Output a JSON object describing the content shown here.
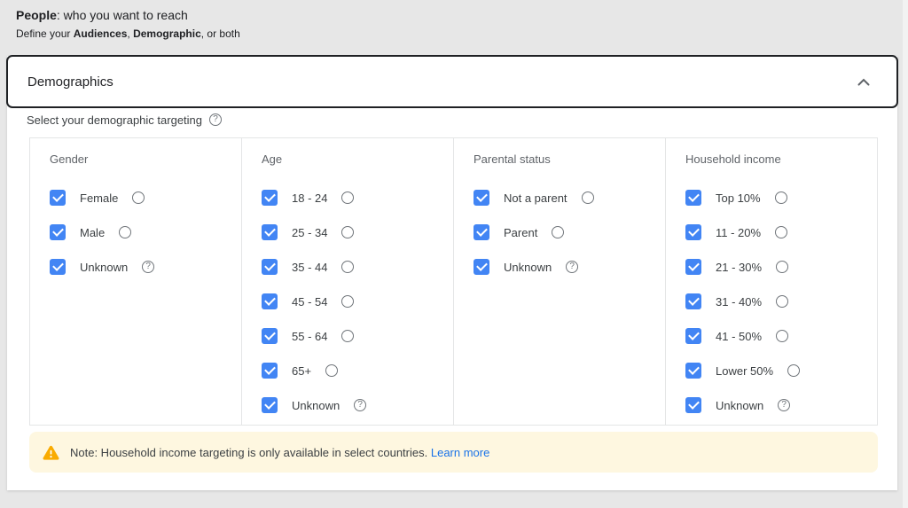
{
  "page_header": {
    "title_bold": "People",
    "title_rest": ": who you want to reach",
    "subtitle_prefix": "Define your ",
    "subtitle_bold1": "Audiences",
    "subtitle_sep": ", ",
    "subtitle_bold2": "Demographic",
    "subtitle_suffix": ", or both"
  },
  "section": {
    "title": "Demographics",
    "collapse_icon": "chevron-up-icon",
    "subtitle": "Select your demographic targeting",
    "subtitle_help_icon": "help-circle-icon",
    "help_glyph": "?"
  },
  "demographics": {
    "columns": [
      {
        "header": "Gender",
        "options": [
          {
            "label": "Female",
            "checked": true
          },
          {
            "label": "Male",
            "checked": true
          },
          {
            "label": "Unknown",
            "checked": true,
            "help": true
          }
        ]
      },
      {
        "header": "Age",
        "options": [
          {
            "label": "18 - 24",
            "checked": true
          },
          {
            "label": "25 - 34",
            "checked": true
          },
          {
            "label": "35 - 44",
            "checked": true
          },
          {
            "label": "45 - 54",
            "checked": true
          },
          {
            "label": "55 - 64",
            "checked": true
          },
          {
            "label": "65+",
            "checked": true
          },
          {
            "label": "Unknown",
            "checked": true,
            "help": true
          }
        ]
      },
      {
        "header": "Parental status",
        "options": [
          {
            "label": "Not a parent",
            "checked": true
          },
          {
            "label": "Parent",
            "checked": true
          },
          {
            "label": "Unknown",
            "checked": true,
            "help": true
          }
        ]
      },
      {
        "header": "Household income",
        "options": [
          {
            "label": "Top 10%",
            "checked": true
          },
          {
            "label": "11 - 20%",
            "checked": true
          },
          {
            "label": "21 - 30%",
            "checked": true
          },
          {
            "label": "31 - 40%",
            "checked": true
          },
          {
            "label": "41 - 50%",
            "checked": true
          },
          {
            "label": "Lower 50%",
            "checked": true
          },
          {
            "label": "Unknown",
            "checked": true,
            "help": true
          }
        ]
      }
    ]
  },
  "note": {
    "icon": "warning-triangle-icon",
    "text": "Note: Household income targeting is only available in select countries.",
    "link_label": "Learn more"
  },
  "colors": {
    "checkbox_blue": "#4285f4",
    "link_blue": "#1a73e8",
    "note_bg": "#fef7e0",
    "warning_amber": "#f9ab00",
    "page_bg": "#e7e7e7",
    "border_dark": "#1f2124"
  }
}
